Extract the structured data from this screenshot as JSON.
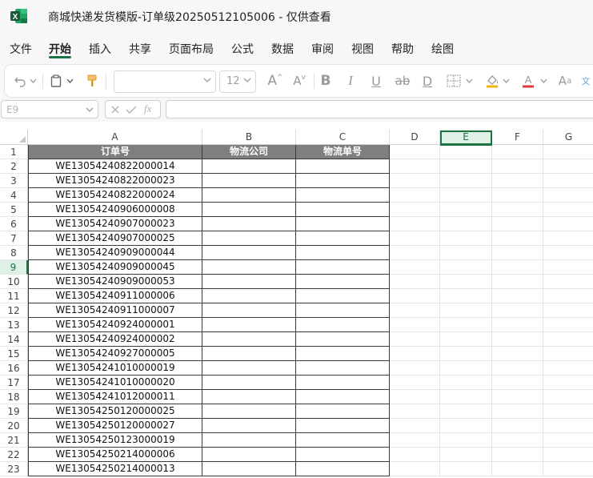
{
  "window": {
    "title": "商城快递发货模版-订单级20250512105006 - 仅供查看"
  },
  "menu": [
    {
      "label": "文件",
      "active": false
    },
    {
      "label": "开始",
      "active": true
    },
    {
      "label": "插入",
      "active": false
    },
    {
      "label": "共享",
      "active": false
    },
    {
      "label": "页面布局",
      "active": false
    },
    {
      "label": "公式",
      "active": false
    },
    {
      "label": "数据",
      "active": false
    },
    {
      "label": "审阅",
      "active": false
    },
    {
      "label": "视图",
      "active": false
    },
    {
      "label": "帮助",
      "active": false
    },
    {
      "label": "绘图",
      "active": false
    }
  ],
  "ribbon": {
    "font_name": "",
    "font_size": "12",
    "icons": [
      "undo-icon",
      "paste-icon",
      "format-painter-icon",
      "increase-font-icon",
      "decrease-font-icon",
      "bold-icon",
      "italic-icon",
      "underline-icon",
      "strikethrough-icon",
      "double-underline-icon",
      "borders-icon",
      "fill-color-icon",
      "font-color-icon",
      "clear-format-icon"
    ],
    "font_color": "#e03b3b",
    "fill_color": "#f0b400"
  },
  "formula_bar": {
    "name_box": "E9",
    "formula": ""
  },
  "sheet": {
    "columns": [
      "A",
      "B",
      "C",
      "D",
      "E",
      "F",
      "G"
    ],
    "selected_column": "E",
    "selected_row": 9,
    "selected_cell": "E9",
    "header_row": [
      "订单号",
      "物流公司",
      "物流单号"
    ],
    "order_ids": [
      "WE13054240822000014",
      "WE13054240822000023",
      "WE13054240822000024",
      "WE13054240906000008",
      "WE13054240907000023",
      "WE13054240907000025",
      "WE13054240909000044",
      "WE13054240909000045",
      "WE13054240909000053",
      "WE13054240911000006",
      "WE13054240911000007",
      "WE13054240924000001",
      "WE13054240924000002",
      "WE13054240927000005",
      "WE13054241010000019",
      "WE13054241010000020",
      "WE13054241012000011",
      "WE13054250120000025",
      "WE13054250120000027",
      "WE13054250123000019",
      "WE13054250214000006",
      "WE13054250214000013"
    ],
    "header_fill": "#7f7f7f",
    "accent": "#1e7145"
  }
}
